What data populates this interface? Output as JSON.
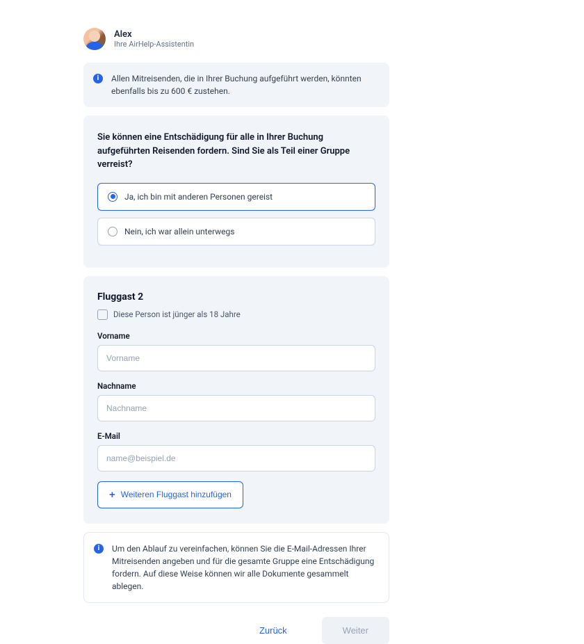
{
  "assistant": {
    "name": "Alex",
    "subtitle": "Ihre AirHelp-Assistentin"
  },
  "info_top": "Allen Mitreisenden, die in Ihrer Buchung aufgeführt werden, könnten ebenfalls bis zu 600 € zustehen.",
  "group_question": "Sie können eine Entschädigung für alle in Ihrer Buchung aufgeführten Reisenden fordern. Sind Sie als Teil einer Gruppe verreist?",
  "options": {
    "yes": "Ja, ich bin mit anderen Personen gereist",
    "no": "Nein, ich war allein unterwegs"
  },
  "passenger": {
    "title": "Fluggast 2",
    "minor_label": "Diese Person ist jünger als 18 Jahre",
    "firstname_label": "Vorname",
    "firstname_placeholder": "Vorname",
    "lastname_label": "Nachname",
    "lastname_placeholder": "Nachname",
    "email_label": "E-Mail",
    "email_placeholder": "name@beispiel.de",
    "add_label": "Weiteren Fluggast hinzufügen"
  },
  "info_bottom": "Um den Ablauf zu vereinfachen, können Sie die E-Mail-Adressen Ihrer Mitreisenden angeben und für die gesamte Gruppe eine Entschädigung fordern. Auf diese Weise können wir alle Dokumente gesammelt ablegen.",
  "buttons": {
    "back": "Zurück",
    "next": "Weiter"
  }
}
